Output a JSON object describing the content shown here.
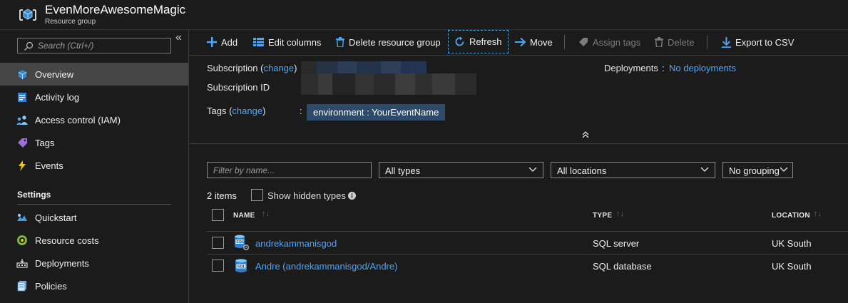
{
  "resource_group": {
    "title": "EvenMoreAwesomeMagic",
    "subtitle": "Resource group"
  },
  "sidebar": {
    "search_placeholder": "Search (Ctrl+/)",
    "items": [
      {
        "label": "Overview",
        "icon": "overview-cube-icon"
      },
      {
        "label": "Activity log",
        "icon": "activity-log-icon"
      },
      {
        "label": "Access control (IAM)",
        "icon": "iam-people-icon"
      },
      {
        "label": "Tags",
        "icon": "tag-icon"
      },
      {
        "label": "Events",
        "icon": "lightning-icon"
      }
    ],
    "settings_title": "Settings",
    "settings_items": [
      {
        "label": "Quickstart",
        "icon": "quickstart-cloud-icon"
      },
      {
        "label": "Resource costs",
        "icon": "cost-icon"
      },
      {
        "label": "Deployments",
        "icon": "deployments-icon"
      },
      {
        "label": "Policies",
        "icon": "policies-icon"
      }
    ]
  },
  "toolbar": {
    "add": "Add",
    "edit_columns": "Edit columns",
    "delete_group": "Delete resource group",
    "refresh": "Refresh",
    "move": "Move",
    "assign_tags": "Assign tags",
    "delete": "Delete",
    "export_csv": "Export to CSV"
  },
  "essentials": {
    "subscription_label": "Subscription (",
    "change": "change",
    "close_paren": ")",
    "subscription_id_label": "Subscription ID",
    "tags_label": "Tags (",
    "tag_value": "environment : YourEventName",
    "deployments_label": "Deployments",
    "deployments_value": "No deployments",
    "colon": ":"
  },
  "filters": {
    "name_placeholder": "Filter by name...",
    "types_value": "All types",
    "locations_value": "All locations",
    "grouping_value": "No grouping"
  },
  "list": {
    "count": "2 items",
    "show_hidden": "Show hidden types",
    "columns": {
      "name": "NAME",
      "type": "TYPE",
      "location": "LOCATION"
    },
    "rows": [
      {
        "name": "andrekammanisgod",
        "type": "SQL server",
        "location": "UK South",
        "icon": "sql-server-icon"
      },
      {
        "name": "Andre (andrekammanisgod/Andre)",
        "type": "SQL database",
        "location": "UK South",
        "icon": "sql-database-icon"
      }
    ]
  },
  "colors": {
    "accent": "#4aa8ff",
    "background": "#1b1b1b",
    "active_nav": "#454545",
    "tag_bg": "#2d4a6b"
  }
}
